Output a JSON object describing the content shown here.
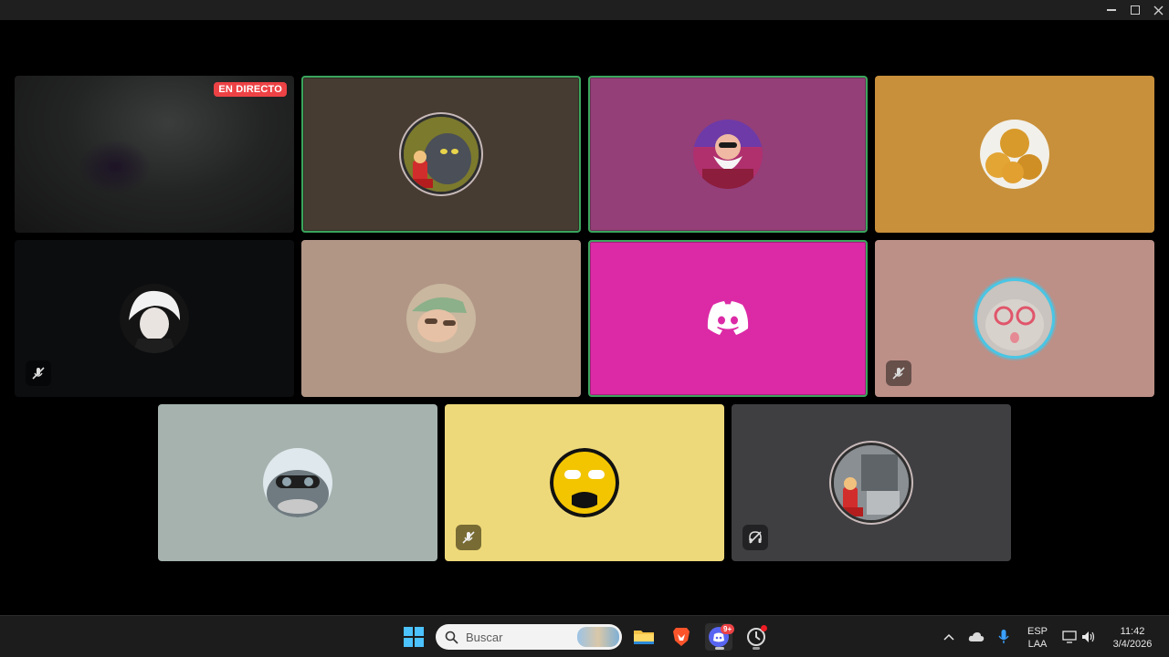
{
  "window": {
    "controls": [
      "minimize",
      "maximize",
      "close"
    ]
  },
  "stage": {
    "live_badge": "EN DIRECTO",
    "tiles": [
      {
        "name": "stream-tile",
        "bg": "#262626",
        "avatar": null,
        "speaking": false,
        "muted": false,
        "live": true
      },
      {
        "name": "participant-tile-1",
        "bg": "#463c32",
        "avatar": "cat-mario-avatar",
        "speaking": true,
        "muted": false
      },
      {
        "name": "participant-tile-2",
        "bg": "#943f78",
        "avatar": "old-master-avatar",
        "speaking": true,
        "muted": false
      },
      {
        "name": "participant-tile-3",
        "bg": "#c8903a",
        "avatar": "food-avatar",
        "speaking": false,
        "muted": false
      },
      {
        "name": "participant-tile-4",
        "bg": "#0c0d0f",
        "avatar": "anime-avatar",
        "speaking": false,
        "muted": true
      },
      {
        "name": "participant-tile-5",
        "bg": "#b19686",
        "avatar": "photo-avatar",
        "speaking": false,
        "muted": false
      },
      {
        "name": "participant-tile-6",
        "bg": "#dc2aa6",
        "avatar": "discord-logo",
        "speaking": true,
        "muted": false
      },
      {
        "name": "participant-tile-7",
        "bg": "#bc9087",
        "avatar": "cat-glasses-avatar",
        "speaking": false,
        "muted": true
      },
      {
        "name": "participant-tile-8",
        "bg": "#a5b2ae",
        "avatar": "shark-avatar",
        "speaking": false,
        "muted": false
      },
      {
        "name": "participant-tile-9",
        "bg": "#eed97a",
        "avatar": "smiley-avatar",
        "speaking": false,
        "muted": true
      },
      {
        "name": "participant-tile-10",
        "bg": "#3f3f42",
        "avatar": "mario-room-avatar",
        "speaking": false,
        "muted": false,
        "deafened": true
      }
    ]
  },
  "taskbar": {
    "search_placeholder": "Buscar",
    "discord_badge": "9+",
    "language": {
      "line1": "ESP",
      "line2": "LAA"
    },
    "clock": {
      "time": "11:42",
      "date": "3/4/2026"
    }
  }
}
